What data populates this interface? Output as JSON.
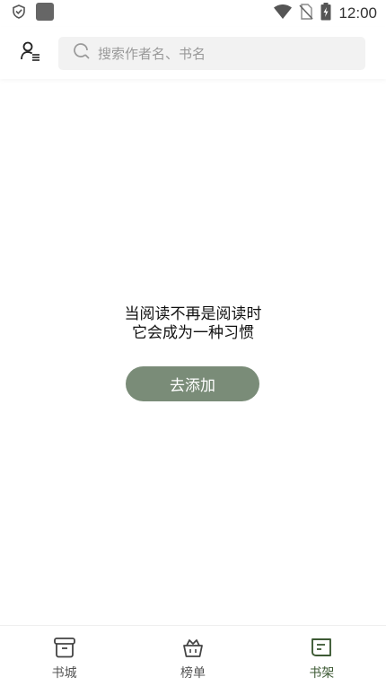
{
  "status_bar": {
    "time": "12:00",
    "icons": [
      "shield-icon",
      "app-square-icon",
      "wifi-icon",
      "no-sim-icon",
      "battery-icon"
    ]
  },
  "header": {
    "search_placeholder": "搜索作者名、书名"
  },
  "empty_state": {
    "line1": "当阅读不再是阅读时",
    "line2": "它会成为一种习惯",
    "add_button": "去添加"
  },
  "bottom_nav": {
    "items": [
      {
        "label": "书城",
        "icon": "bookstore-icon",
        "active": false
      },
      {
        "label": "榜单",
        "icon": "crown-basket-icon",
        "active": false
      },
      {
        "label": "书架",
        "icon": "bookshelf-icon",
        "active": true
      }
    ]
  },
  "colors": {
    "accent": "#7a8c78",
    "active_nav": "#3d5a34",
    "search_bg": "#f2f2f2",
    "placeholder": "#999999"
  }
}
